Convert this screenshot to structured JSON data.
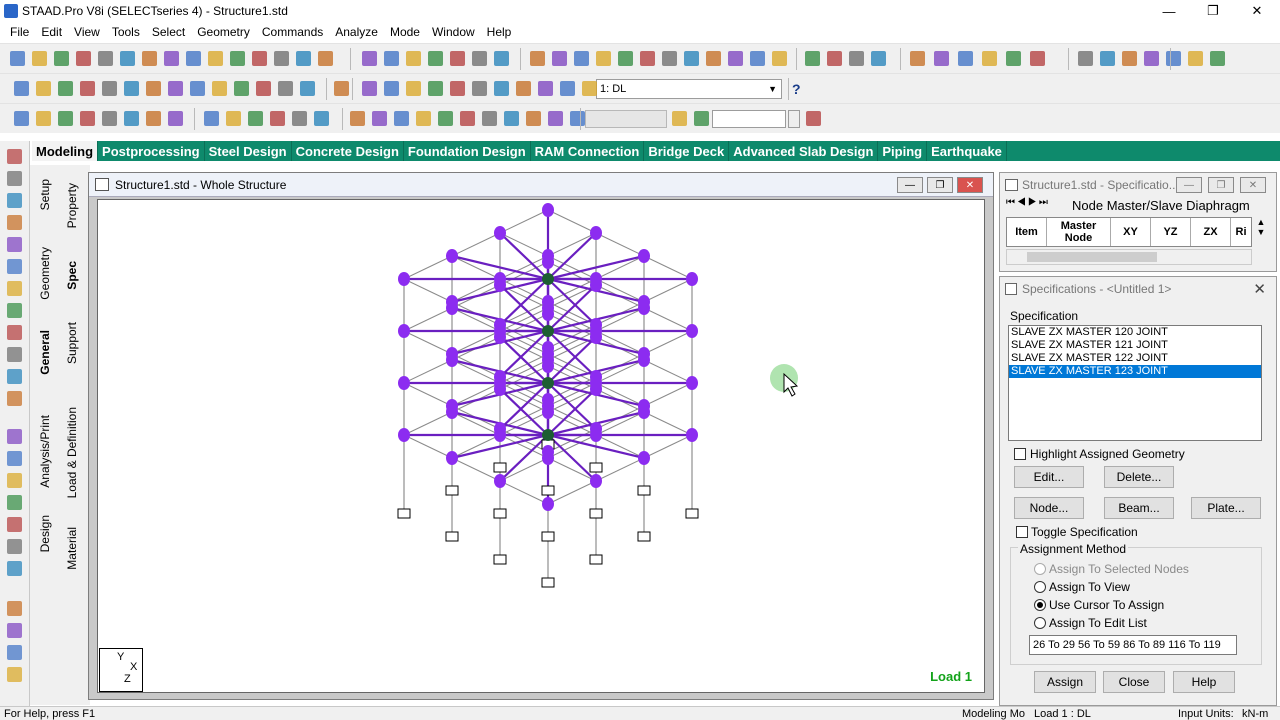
{
  "titlebar": {
    "title": "STAAD.Pro V8i (SELECTseries 4) - Structure1.std",
    "minimize": "—",
    "restore": "❐",
    "close": "✕"
  },
  "menu": [
    "File",
    "Edit",
    "View",
    "Tools",
    "Select",
    "Geometry",
    "Commands",
    "Analyze",
    "Mode",
    "Window",
    "Help"
  ],
  "toolbar": {
    "load_select": "1: DL",
    "help_symbol": "?"
  },
  "tabs": [
    "Modeling",
    "Postprocessing",
    "Steel Design",
    "Concrete Design",
    "Foundation Design",
    "RAM Connection",
    "Bridge Deck",
    "Advanced Slab Design",
    "Piping",
    "Earthquake"
  ],
  "vertical_tabs": {
    "col1": [
      "Setup",
      "Geometry",
      "General",
      "Analysis/Print",
      "Design"
    ],
    "col2": [
      "Property",
      "Spec",
      "Support",
      "Load & Definition",
      "Material"
    ]
  },
  "view_window": {
    "title": "Structure1.std - Whole Structure",
    "load_label": "Load 1",
    "axis": {
      "y": "Y",
      "x": "X",
      "z": "Z"
    }
  },
  "spec_table_window": {
    "title": "Structure1.std - Specificatio...",
    "tab_label": "Node Master/Slave Diaphragm",
    "columns": [
      "Item",
      "Master Node",
      "XY",
      "YZ",
      "ZX",
      "Ri"
    ]
  },
  "spec_panel": {
    "title": "Specifications - <Untitled 1>",
    "section_label": "Specification",
    "items": [
      "SLAVE ZX MASTER 120 JOINT",
      "SLAVE ZX MASTER 121 JOINT",
      "SLAVE ZX MASTER 122 JOINT",
      "SLAVE ZX MASTER 123 JOINT"
    ],
    "selected_index": 3,
    "highlight_label": "Highlight Assigned Geometry",
    "edit_btn": "Edit...",
    "delete_btn": "Delete...",
    "node_btn": "Node...",
    "beam_btn": "Beam...",
    "plate_btn": "Plate...",
    "toggle_label": "Toggle Specification",
    "assign_method_label": "Assignment Method",
    "radio_options": [
      "Assign To Selected Nodes",
      "Assign To View",
      "Use Cursor To Assign",
      "Assign To Edit List"
    ],
    "radio_selected": 2,
    "edit_list_value": "26 To 29 56 To 59 86 To 89 116 To 119",
    "assign_btn": "Assign",
    "close_btn": "Close",
    "help_btn": "Help"
  },
  "status": {
    "left": "For Help, press F1",
    "mode": "Modeling Mo",
    "load": "Load 1 : DL",
    "units_label": "Input Units:",
    "units_value": "kN-m"
  },
  "colors": {
    "tab_green": "#0e8a6c",
    "member_purple": "#6a1fc0",
    "node_purple": "#8c2cf0",
    "master_node": "#1d5e33",
    "load_green": "#13a31a",
    "selection_blue": "#0078d7"
  }
}
